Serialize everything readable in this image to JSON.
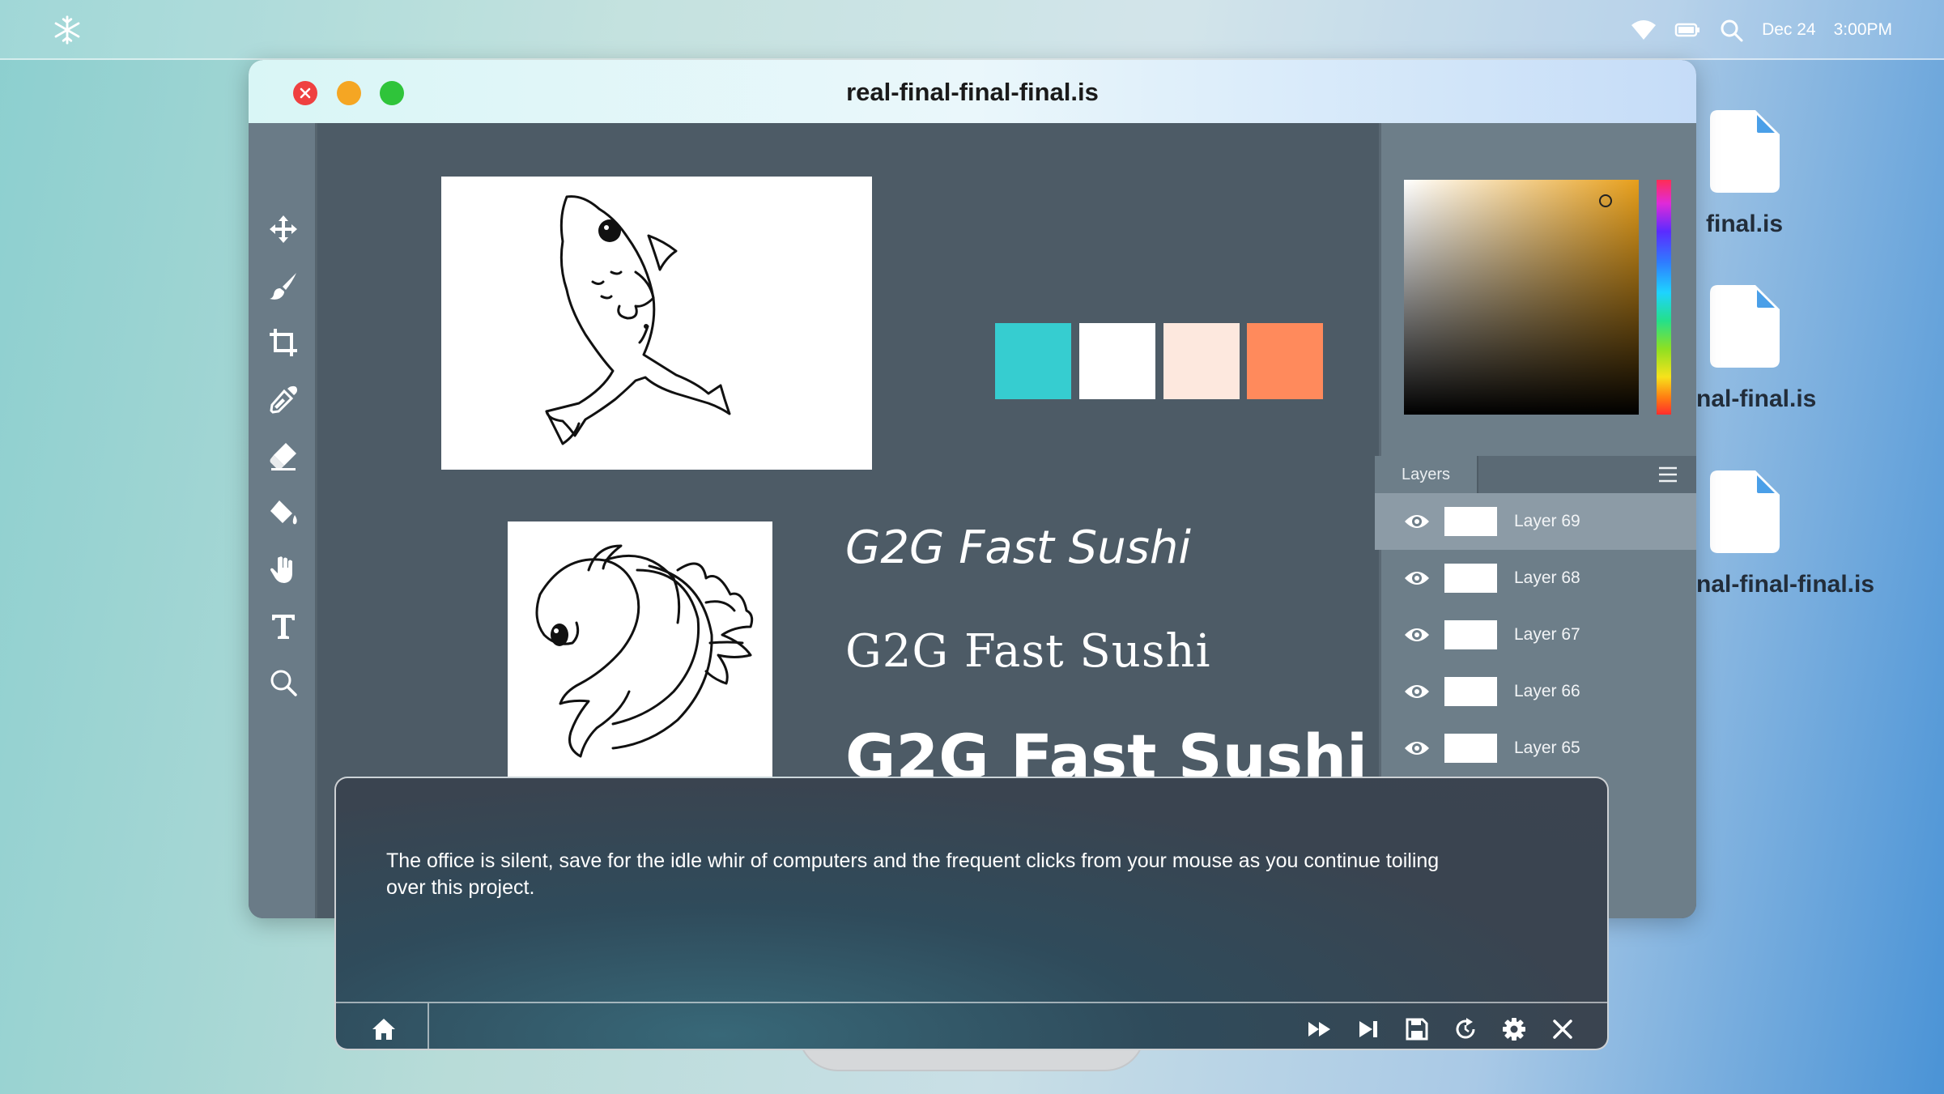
{
  "menubar": {
    "logo_icon": "snowflake-icon",
    "date": "Dec 24",
    "time": "3:00PM"
  },
  "desktop": {
    "files": [
      {
        "label": "final.is"
      },
      {
        "label": "nal-final.is"
      },
      {
        "label": "nal-final-final.is"
      }
    ]
  },
  "window": {
    "title": "real-final-final-final.is"
  },
  "tools": [
    "move-icon",
    "brush-icon",
    "crop-icon",
    "eyedropper-icon",
    "eraser-icon",
    "paint-bucket-icon",
    "hand-icon",
    "text-icon",
    "zoom-icon"
  ],
  "canvas": {
    "swatches": [
      "#36cdd0",
      "#ffffff",
      "#fde8de",
      "#ff8a5c"
    ],
    "font_samples": [
      "G2G Fast Sushi",
      "G2G Fast Sushi",
      "G2G Fast Sushi"
    ]
  },
  "color_picker": {
    "hue_color": "#e79f1b"
  },
  "layers": {
    "tab_label": "Layers",
    "items": [
      {
        "name": "Layer 69",
        "active": true
      },
      {
        "name": "Layer 68"
      },
      {
        "name": "Layer 67"
      },
      {
        "name": "Layer 66"
      },
      {
        "name": "Layer 65"
      }
    ]
  },
  "dialogue": {
    "text": "The office is silent, save for the idle whir of computers and the frequent clicks from your mouse as you continue toiling over this project.",
    "controls": [
      "home-icon",
      "fast-forward-icon",
      "skip-icon",
      "save-icon",
      "reload-icon",
      "settings-icon",
      "close-icon"
    ]
  }
}
